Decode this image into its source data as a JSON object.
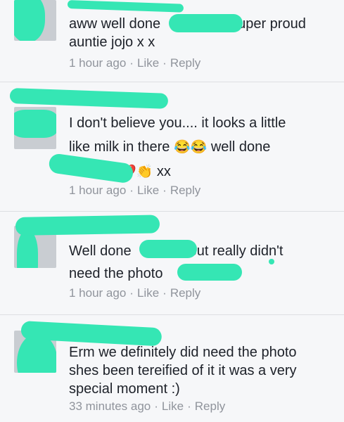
{
  "comments": [
    {
      "line1_before": "aww well done",
      "line1_after": "super proud",
      "line2": "auntie jojo x x",
      "time": "1 hour ago",
      "like": "Like",
      "reply": "Reply"
    },
    {
      "line1": "I don't believe you.... it looks a little",
      "line2_before": "like milk in there",
      "line2_emoji": "😂😂",
      "line2_after": "well done",
      "line3_emoji": "❤️👏",
      "line3_after": "xx",
      "time": "1 hour ago",
      "like": "Like",
      "reply": "Reply"
    },
    {
      "line1_before": "Well done",
      "line1_after": "but really didn't",
      "line2": "need the photo",
      "time": "1 hour ago",
      "like": "Like",
      "reply": "Reply"
    },
    {
      "line1": "Erm we definitely did need the photo",
      "line2": "shes been tereified of it it was a very",
      "line3": "special moment :)",
      "time": "33 minutes ago",
      "like": "Like",
      "reply": "Reply"
    }
  ],
  "separator": "·",
  "colors": {
    "background": "#f6f7f9",
    "text": "#1d2129",
    "meta": "#90949c",
    "redaction": "#35e6b4"
  }
}
